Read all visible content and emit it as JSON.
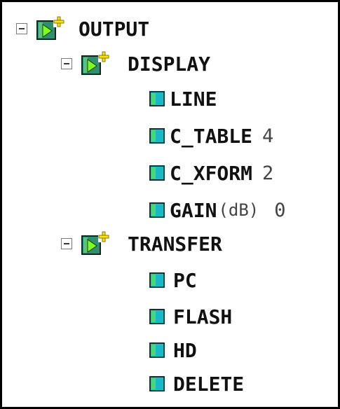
{
  "tree": {
    "output": {
      "label": "OUTPUT",
      "display": {
        "label": "DISPLAY",
        "items": [
          {
            "label": "LINE",
            "value": ""
          },
          {
            "label": "C_TABLE",
            "value": "4"
          },
          {
            "label": "C_XFORM",
            "value": "2"
          },
          {
            "label": "GAIN",
            "unit": "(dB)",
            "value": "0"
          }
        ]
      },
      "transfer": {
        "label": "TRANSFER",
        "items": [
          {
            "label": "PC"
          },
          {
            "label": "FLASH"
          },
          {
            "label": "HD"
          },
          {
            "label": "DELETE"
          }
        ]
      }
    }
  },
  "icons": {
    "folder": "folder-add-icon",
    "leaf": "leaf-node-icon",
    "toggle": "collapse-icon"
  },
  "colors": {
    "folder_fill": "#2f8f6f",
    "folder_arrow": "#7fff1f",
    "plus": "#ffe600",
    "leaf_fill": "#19c6c6",
    "leaf_border": "#063a3a"
  }
}
